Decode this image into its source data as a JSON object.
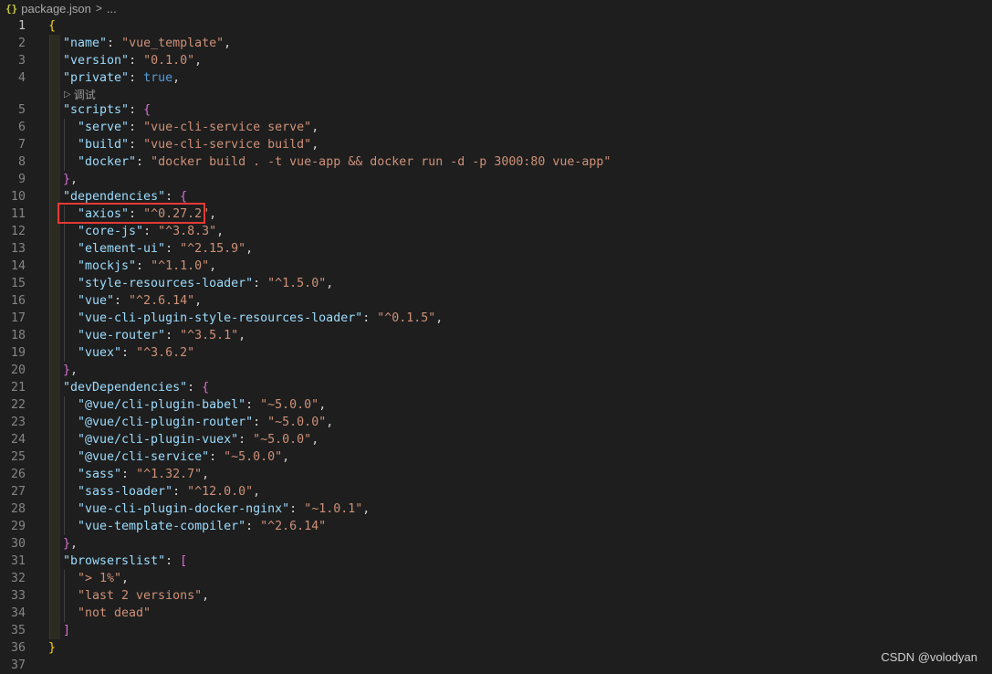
{
  "breadcrumb": {
    "icon": "{}",
    "file": "package.json",
    "separator": ">",
    "more": "..."
  },
  "codelens": {
    "label": "调试"
  },
  "watermark": "CSDN @volodyan",
  "colors": {
    "background": "#1e1e1e",
    "key": "#9cdcfe",
    "string": "#ce9178",
    "boolean": "#569cd6",
    "bracket_level1": "#ffd700",
    "bracket_level2": "#da70d6",
    "highlight": "#e53935"
  },
  "lines": [
    {
      "n": "1",
      "t": [
        [
          "br1",
          "{"
        ]
      ]
    },
    {
      "n": "2",
      "t": [
        [
          "k",
          "\"name\""
        ],
        [
          "p",
          ": "
        ],
        [
          "s",
          "\"vue_template\""
        ],
        [
          "p",
          ","
        ]
      ]
    },
    {
      "n": "3",
      "t": [
        [
          "k",
          "\"version\""
        ],
        [
          "p",
          ": "
        ],
        [
          "s",
          "\"0.1.0\""
        ],
        [
          "p",
          ","
        ]
      ]
    },
    {
      "n": "4",
      "t": [
        [
          "k",
          "\"private\""
        ],
        [
          "p",
          ": "
        ],
        [
          "b",
          "true"
        ],
        [
          "p",
          ","
        ]
      ]
    },
    {
      "n": "5",
      "t": [
        [
          "k",
          "\"scripts\""
        ],
        [
          "p",
          ": "
        ],
        [
          "br2",
          "{"
        ]
      ]
    },
    {
      "n": "6",
      "t": [
        [
          "k",
          "\"serve\""
        ],
        [
          "p",
          ": "
        ],
        [
          "s",
          "\"vue-cli-service serve\""
        ],
        [
          "p",
          ","
        ]
      ]
    },
    {
      "n": "7",
      "t": [
        [
          "k",
          "\"build\""
        ],
        [
          "p",
          ": "
        ],
        [
          "s",
          "\"vue-cli-service build\""
        ],
        [
          "p",
          ","
        ]
      ]
    },
    {
      "n": "8",
      "t": [
        [
          "k",
          "\"docker\""
        ],
        [
          "p",
          ": "
        ],
        [
          "s",
          "\"docker build . -t vue-app && docker run -d -p 3000:80 vue-app\""
        ]
      ]
    },
    {
      "n": "9",
      "t": [
        [
          "br2",
          "}"
        ],
        [
          "p",
          ","
        ]
      ]
    },
    {
      "n": "10",
      "t": [
        [
          "k",
          "\"dependencies\""
        ],
        [
          "p",
          ": "
        ],
        [
          "br2",
          "{"
        ]
      ]
    },
    {
      "n": "11",
      "t": [
        [
          "k",
          "\"axios\""
        ],
        [
          "p",
          ": "
        ],
        [
          "s",
          "\"^0.27.2\""
        ],
        [
          "p",
          ","
        ]
      ]
    },
    {
      "n": "12",
      "t": [
        [
          "k",
          "\"core-js\""
        ],
        [
          "p",
          ": "
        ],
        [
          "s",
          "\"^3.8.3\""
        ],
        [
          "p",
          ","
        ]
      ]
    },
    {
      "n": "13",
      "t": [
        [
          "k",
          "\"element-ui\""
        ],
        [
          "p",
          ": "
        ],
        [
          "s",
          "\"^2.15.9\""
        ],
        [
          "p",
          ","
        ]
      ]
    },
    {
      "n": "14",
      "t": [
        [
          "k",
          "\"mockjs\""
        ],
        [
          "p",
          ": "
        ],
        [
          "s",
          "\"^1.1.0\""
        ],
        [
          "p",
          ","
        ]
      ]
    },
    {
      "n": "15",
      "t": [
        [
          "k",
          "\"style-resources-loader\""
        ],
        [
          "p",
          ": "
        ],
        [
          "s",
          "\"^1.5.0\""
        ],
        [
          "p",
          ","
        ]
      ]
    },
    {
      "n": "16",
      "t": [
        [
          "k",
          "\"vue\""
        ],
        [
          "p",
          ": "
        ],
        [
          "s",
          "\"^2.6.14\""
        ],
        [
          "p",
          ","
        ]
      ]
    },
    {
      "n": "17",
      "t": [
        [
          "k",
          "\"vue-cli-plugin-style-resources-loader\""
        ],
        [
          "p",
          ": "
        ],
        [
          "s",
          "\"^0.1.5\""
        ],
        [
          "p",
          ","
        ]
      ]
    },
    {
      "n": "18",
      "t": [
        [
          "k",
          "\"vue-router\""
        ],
        [
          "p",
          ": "
        ],
        [
          "s",
          "\"^3.5.1\""
        ],
        [
          "p",
          ","
        ]
      ]
    },
    {
      "n": "19",
      "t": [
        [
          "k",
          "\"vuex\""
        ],
        [
          "p",
          ": "
        ],
        [
          "s",
          "\"^3.6.2\""
        ]
      ]
    },
    {
      "n": "20",
      "t": [
        [
          "br2",
          "}"
        ],
        [
          "p",
          ","
        ]
      ]
    },
    {
      "n": "21",
      "t": [
        [
          "k",
          "\"devDependencies\""
        ],
        [
          "p",
          ": "
        ],
        [
          "br2",
          "{"
        ]
      ]
    },
    {
      "n": "22",
      "t": [
        [
          "k",
          "\"@vue/cli-plugin-babel\""
        ],
        [
          "p",
          ": "
        ],
        [
          "s",
          "\"~5.0.0\""
        ],
        [
          "p",
          ","
        ]
      ]
    },
    {
      "n": "23",
      "t": [
        [
          "k",
          "\"@vue/cli-plugin-router\""
        ],
        [
          "p",
          ": "
        ],
        [
          "s",
          "\"~5.0.0\""
        ],
        [
          "p",
          ","
        ]
      ]
    },
    {
      "n": "24",
      "t": [
        [
          "k",
          "\"@vue/cli-plugin-vuex\""
        ],
        [
          "p",
          ": "
        ],
        [
          "s",
          "\"~5.0.0\""
        ],
        [
          "p",
          ","
        ]
      ]
    },
    {
      "n": "25",
      "t": [
        [
          "k",
          "\"@vue/cli-service\""
        ],
        [
          "p",
          ": "
        ],
        [
          "s",
          "\"~5.0.0\""
        ],
        [
          "p",
          ","
        ]
      ]
    },
    {
      "n": "26",
      "t": [
        [
          "k",
          "\"sass\""
        ],
        [
          "p",
          ": "
        ],
        [
          "s",
          "\"^1.32.7\""
        ],
        [
          "p",
          ","
        ]
      ]
    },
    {
      "n": "27",
      "t": [
        [
          "k",
          "\"sass-loader\""
        ],
        [
          "p",
          ": "
        ],
        [
          "s",
          "\"^12.0.0\""
        ],
        [
          "p",
          ","
        ]
      ]
    },
    {
      "n": "28",
      "t": [
        [
          "k",
          "\"vue-cli-plugin-docker-nginx\""
        ],
        [
          "p",
          ": "
        ],
        [
          "s",
          "\"~1.0.1\""
        ],
        [
          "p",
          ","
        ]
      ]
    },
    {
      "n": "29",
      "t": [
        [
          "k",
          "\"vue-template-compiler\""
        ],
        [
          "p",
          ": "
        ],
        [
          "s",
          "\"^2.6.14\""
        ]
      ]
    },
    {
      "n": "30",
      "t": [
        [
          "br2",
          "}"
        ],
        [
          "p",
          ","
        ]
      ]
    },
    {
      "n": "31",
      "t": [
        [
          "k",
          "\"browserslist\""
        ],
        [
          "p",
          ": "
        ],
        [
          "br2",
          "["
        ]
      ]
    },
    {
      "n": "32",
      "t": [
        [
          "s",
          "\"> 1%\""
        ],
        [
          "p",
          ","
        ]
      ]
    },
    {
      "n": "33",
      "t": [
        [
          "s",
          "\"last 2 versions\""
        ],
        [
          "p",
          ","
        ]
      ]
    },
    {
      "n": "34",
      "t": [
        [
          "s",
          "\"not dead\""
        ]
      ]
    },
    {
      "n": "35",
      "t": [
        [
          "br2",
          "]"
        ]
      ]
    },
    {
      "n": "36",
      "t": [
        [
          "br1",
          "}"
        ]
      ]
    },
    {
      "n": "37",
      "t": []
    }
  ]
}
